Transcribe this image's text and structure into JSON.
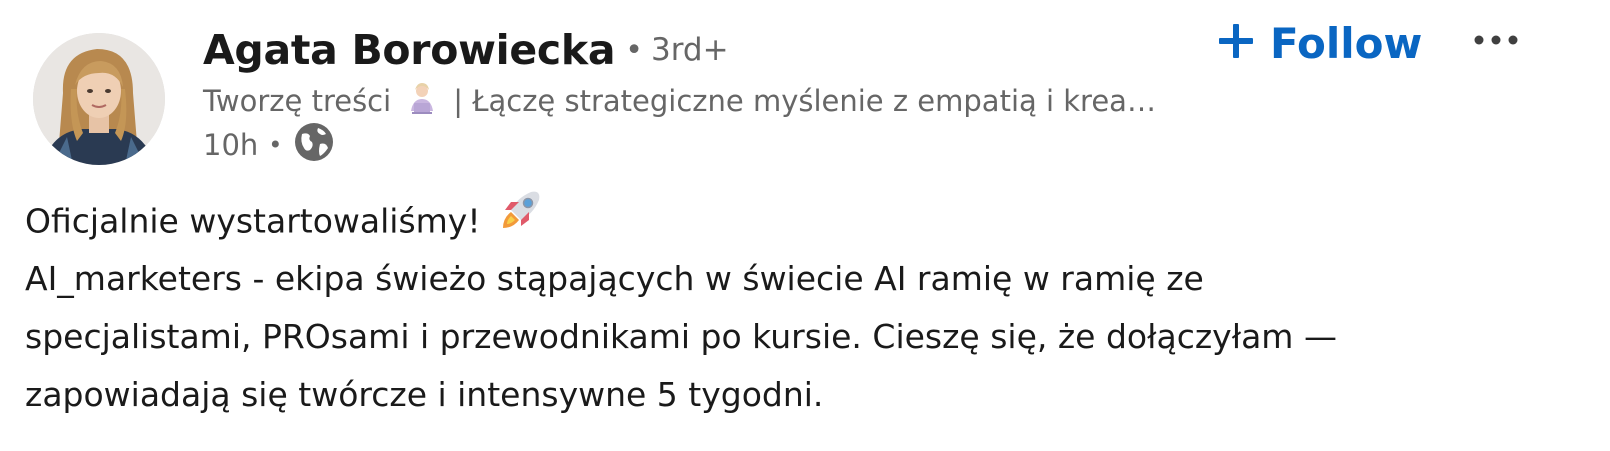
{
  "post": {
    "author": {
      "name": "Agata Borowiecka",
      "degree": "3rd+",
      "headline_start": "Tworzę treści",
      "headline_rest": "| Łączę strategiczne myślenie z empatią i krea…",
      "headline_emoji": "person-with-laptop-emoji",
      "time": "10h",
      "visibility_icon": "globe-icon"
    },
    "follow": {
      "label": "Follow",
      "icon": "plus-icon"
    },
    "more_icon": "ellipsis-icon",
    "body": {
      "line1": "Oficjalnie wystartowaliśmy!",
      "line1_emoji": "rocket-emoji",
      "line2": "AI_marketers - ekipa świeżo stąpających w świecie AI ramię w ramię ze",
      "line3": "specjalistami, PROsami i przewodnikami po kursie. Cieszę się, że dołączyłam —",
      "line4": "zapowiadają się twórcze i intensywne 5 tygodni."
    },
    "colors": {
      "accent": "#0a66c2",
      "secondary_text": "#666666",
      "primary_text": "#1a1a1a"
    }
  }
}
